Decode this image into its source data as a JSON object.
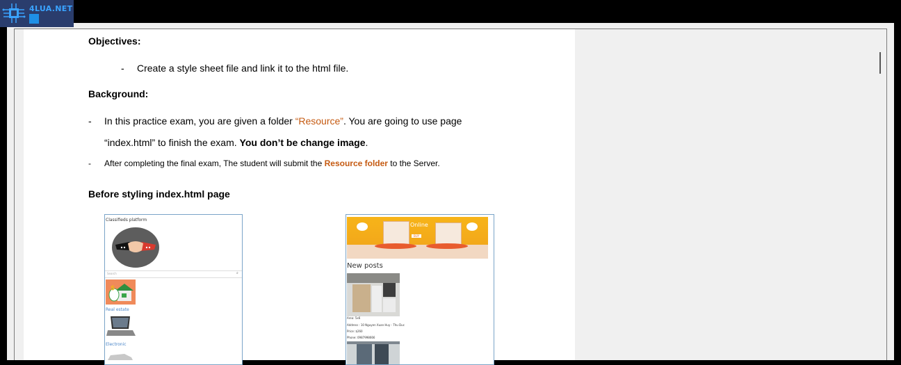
{
  "logo": {
    "text": "4LUA.NET"
  },
  "document": {
    "objectives_heading": "Objectives:",
    "objectives_items": [
      "Create a style sheet file and link it to the html file."
    ],
    "background_heading": "Background:",
    "bullet1_part1": "In this practice exam, you are given a folder ",
    "bullet1_highlight": "“Resource”",
    "bullet1_part2": ". You are going to use page",
    "bullet1_line2_part1": "“index.html”  to finish the exam. ",
    "bullet1_line2_bold": "You don’t be change image",
    "bullet1_line2_end": ".",
    "bullet2_part1": "After completing the final exam, The student will submit the ",
    "bullet2_highlight": "Resource folder",
    "bullet2_part2": " to the Server.",
    "before_heading": "Before styling index.html page",
    "dash": "-"
  },
  "screenshot_left": {
    "title": "Classifieds platform",
    "search_placeholder": "Search",
    "categories": [
      "Real estate",
      "Electronic"
    ]
  },
  "screenshot_right": {
    "banner_text": "Online",
    "banner_button": "BUY",
    "section_title": "New posts",
    "post_details": [
      "Area: 5x6",
      "Address : 10 Nguyen Xuan Huy - Thu Duc",
      "Price: $260",
      "Phone: 0987998666"
    ]
  },
  "colors": {
    "accent_orange": "#c55a11",
    "link_blue": "#4a86c8",
    "logo_bg": "#2a3d6d"
  }
}
